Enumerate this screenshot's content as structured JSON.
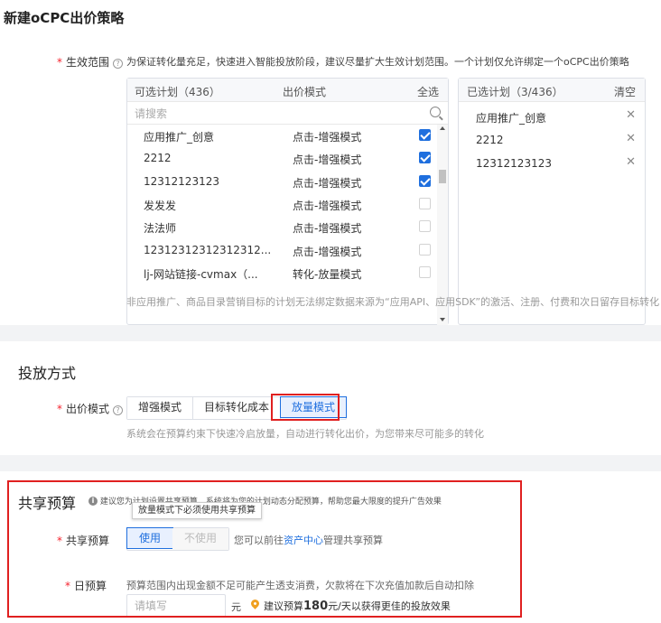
{
  "page": {
    "title": "新建oCPC出价策略"
  },
  "scope": {
    "label": "生效范围",
    "description": "为保证转化量充足，快速进入智能投放阶段，建议尽量扩大生效计划范围。一个计划仅允许绑定一个oCPC出价策略",
    "available": {
      "header_title": "可选计划（436）",
      "header_mode": "出价模式",
      "select_all": "全选",
      "search_placeholder": "请搜索",
      "items": [
        {
          "name": "应用推广_创意",
          "mode": "点击-增强模式",
          "checked": true
        },
        {
          "name": "2212",
          "mode": "点击-增强模式",
          "checked": true
        },
        {
          "name": "12312123123",
          "mode": "点击-增强模式",
          "checked": true
        },
        {
          "name": "发发发",
          "mode": "点击-增强模式",
          "checked": false
        },
        {
          "name": "法法师",
          "mode": "点击-增强模式",
          "checked": false
        },
        {
          "name": "12312312312312312...",
          "mode": "点击-增强模式",
          "checked": false
        },
        {
          "name": "lj-网站链接-cvmax（...",
          "mode": "转化-放量模式",
          "checked": false
        }
      ]
    },
    "selected": {
      "header_title": "已选计划（3/436）",
      "clear": "清空",
      "items": [
        "应用推广_创意",
        "2212",
        "12312123123"
      ]
    },
    "footnote": "非应用推广、商品目录营销目标的计划无法绑定数据来源为“应用API、应用SDK”的激活、注册、付费和次日留存目标转化"
  },
  "delivery": {
    "section_title": "投放方式",
    "bid_label": "出价模式",
    "modes": [
      "增强模式",
      "目标转化成本",
      "放量模式"
    ],
    "active_mode": "放量模式",
    "hint": "系统会在预算约束下快速冷启放量，自动进行转化出价，为您带来尽可能多的转化"
  },
  "budget": {
    "section_title": "共享预算",
    "info_text": "建议您为计划设置共享预算，系统将为您的计划动态分配预算，帮助您最大限度的提升广告效果",
    "tooltip": "放量模式下必须使用共享预算",
    "shared_label": "共享预算",
    "shared_options": [
      "使用",
      "不使用"
    ],
    "shared_active": "使用",
    "shared_hint_prefix": "您可以前往",
    "shared_hint_link": "资产中心",
    "shared_hint_suffix": "管理共享预算",
    "daily_label": "日预算",
    "daily_desc": "预算范围内出现金额不足可能产生透支消费，欠款将在下次充值加款后自动扣除",
    "daily_placeholder": "请填写",
    "unit": "元",
    "suggest_prefix": "建议预算",
    "suggest_value": "180",
    "suggest_suffix": "元/天以获得更佳的投放效果"
  },
  "colors": {
    "primary": "#1f6fde",
    "required": "#f5222d",
    "highlight_box": "#e02020"
  }
}
